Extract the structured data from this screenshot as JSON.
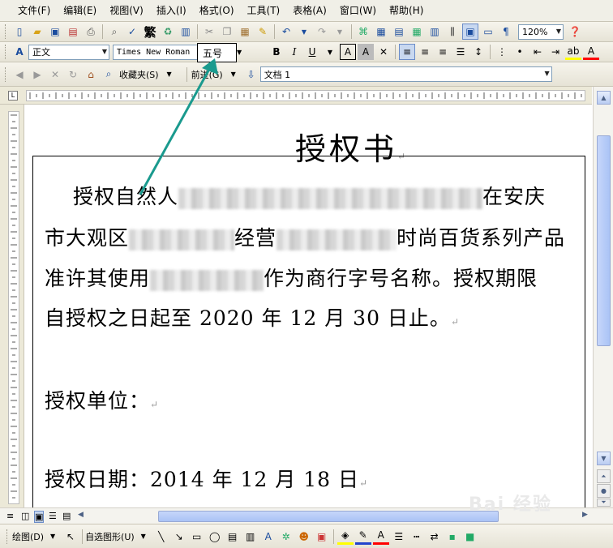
{
  "menu": [
    "文件(F)",
    "编辑(E)",
    "视图(V)",
    "插入(I)",
    "格式(O)",
    "工具(T)",
    "表格(A)",
    "窗口(W)",
    "帮助(H)"
  ],
  "toolbar": {
    "zoom": "120%",
    "fan_label": "繁"
  },
  "format": {
    "style": "正文",
    "font": "Times New Roman",
    "size": "五号",
    "highlight_color": "#ffff00",
    "font_color": "#ff0000"
  },
  "web": {
    "favorites": "收藏夹(S)",
    "forward": "前进(G)",
    "address": "文档 1"
  },
  "document": {
    "title": "授权书",
    "p1_start": "授权自然人",
    "p1_end": "在安庆",
    "p2_start": "市大观区",
    "p2_mid": "经营",
    "p2_end": "时尚百货系列产品",
    "p3_start": "准许其使用",
    "p3_end": "作为商行字号名称。授权期限",
    "p4": "自授权之日起至 2020 年 12 月 30 日止。",
    "unit": "授权单位：",
    "date": "授权日期：2014 年 12 月 18 日"
  },
  "drawbar": {
    "draw": "绘图(D)",
    "autoshapes": "自选图形(U)"
  },
  "watermark": "Bai 经验",
  "colors": {
    "arrow": "#1a9a8e"
  }
}
